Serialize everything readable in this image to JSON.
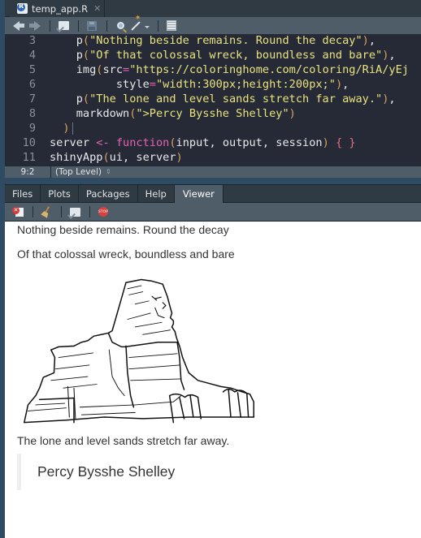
{
  "source": {
    "file_tab": {
      "name": "temp_app.R",
      "icon": "r-file-icon",
      "close_icon": "close-icon"
    },
    "toolbar": {
      "buttons": [
        {
          "name": "back",
          "icon": "arrow-left-icon"
        },
        {
          "name": "forward",
          "icon": "arrow-right-icon"
        },
        {
          "name": "show-in-new-window",
          "icon": "new-window-icon"
        },
        {
          "name": "save",
          "icon": "save-icon"
        },
        {
          "name": "find-replace",
          "icon": "search-icon"
        },
        {
          "name": "code-tools",
          "icon": "magic-wand-icon"
        },
        {
          "name": "compile-report",
          "icon": "notebook-icon"
        }
      ]
    },
    "lines": [
      {
        "num": "3",
        "tokens": [
          [
            "fn",
            "    p"
          ],
          [
            "paren",
            "("
          ],
          [
            "str",
            "\"Nothing beside remains. Round the decay\""
          ],
          [
            "paren",
            ")"
          ],
          [
            "fn",
            ","
          ]
        ]
      },
      {
        "num": "4",
        "tokens": [
          [
            "fn",
            "    p"
          ],
          [
            "paren",
            "("
          ],
          [
            "str",
            "\"Of that colossal wreck, boundless and bare\""
          ],
          [
            "paren",
            ")"
          ],
          [
            "fn",
            ","
          ]
        ]
      },
      {
        "num": "5",
        "tokens": [
          [
            "fn",
            "    img"
          ],
          [
            "paren",
            "("
          ],
          [
            "fn",
            "src"
          ],
          [
            "op",
            "="
          ],
          [
            "str",
            "\"https://coloringhome.com/coloring/RiA/yEj"
          ]
        ]
      },
      {
        "num": "6",
        "tokens": [
          [
            "fn",
            "          style"
          ],
          [
            "op",
            "="
          ],
          [
            "str",
            "\"width:300px;height:200px;\""
          ],
          [
            "paren",
            ")"
          ],
          [
            "fn",
            ","
          ]
        ]
      },
      {
        "num": "7",
        "tokens": [
          [
            "fn",
            "    p"
          ],
          [
            "paren",
            "("
          ],
          [
            "str",
            "\"The lone and level sands stretch far away.\""
          ],
          [
            "paren",
            ")"
          ],
          [
            "fn",
            ","
          ]
        ]
      },
      {
        "num": "8",
        "tokens": [
          [
            "fn",
            "    markdown"
          ],
          [
            "paren",
            "("
          ],
          [
            "str",
            "\">Percy Bysshe Shelley\""
          ],
          [
            "paren",
            ")"
          ]
        ]
      },
      {
        "num": "9",
        "tokens": [
          [
            "paren",
            "  )"
          ]
        ],
        "cursor": true
      },
      {
        "num": "10",
        "tokens": [
          [
            "fn",
            "server "
          ],
          [
            "op",
            "<-"
          ],
          [
            "fn",
            " "
          ],
          [
            "kw",
            "function"
          ],
          [
            "paren",
            "("
          ],
          [
            "fn",
            "input, output, session"
          ],
          [
            "paren",
            ")"
          ],
          [
            "fn",
            " "
          ],
          [
            "brace",
            "{ }"
          ]
        ]
      },
      {
        "num": "11",
        "tokens": [
          [
            "fn",
            "shinyApp"
          ],
          [
            "paren",
            "("
          ],
          [
            "fn",
            "ui, server"
          ],
          [
            "paren",
            ")"
          ]
        ]
      }
    ],
    "status": {
      "position": "9:2",
      "scope": "(Top Level)"
    }
  },
  "viewer": {
    "tabs": [
      {
        "label": "Files",
        "active": false
      },
      {
        "label": "Plots",
        "active": false
      },
      {
        "label": "Packages",
        "active": false
      },
      {
        "label": "Help",
        "active": false
      },
      {
        "label": "Viewer",
        "active": true
      }
    ],
    "toolbar": {
      "buttons": [
        {
          "name": "remove-viewer",
          "icon": "remove-icon"
        },
        {
          "name": "clear-all",
          "icon": "broom-icon"
        },
        {
          "name": "show-in-new-window",
          "icon": "new-window-icon"
        },
        {
          "name": "stop",
          "icon": "stop-icon",
          "label": "STOP"
        }
      ]
    },
    "content": {
      "line1": "Nothing beside remains. Round the decay",
      "line2": "Of that colossal wreck, boundless and bare",
      "image_alt": "Line drawing of the Great Sphinx",
      "line3": "The lone and level sands stretch far away.",
      "quote": "Percy Bysshe Shelley"
    }
  }
}
